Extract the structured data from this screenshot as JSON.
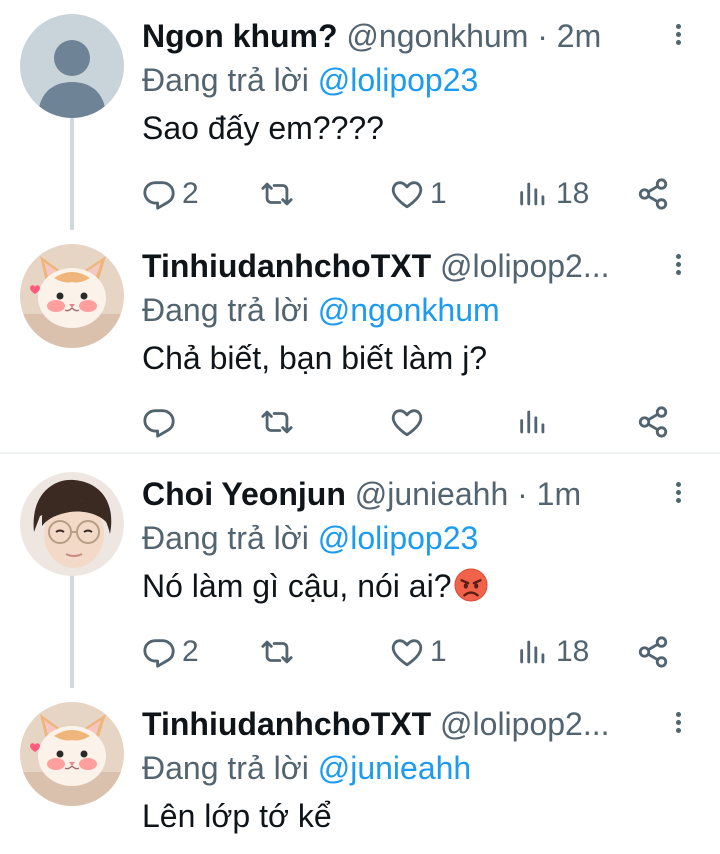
{
  "colors": {
    "text": "#0f1419",
    "secondary": "#536471",
    "link": "#1d9bf0",
    "thread_line": "#cfd9de",
    "divider": "#eff3f4"
  },
  "tweets": [
    {
      "display_name": "Ngon khum?",
      "meta": "@ngonkhum · 2m",
      "reply_prefix": "Đang trả lời",
      "reply_to": "@lolipop23",
      "text": "Sao đấy em????",
      "avatar": "default-avatar",
      "stats": {
        "replies": "2",
        "retweets": "",
        "likes": "1",
        "views": "18"
      }
    },
    {
      "display_name": "TinhiudanhchoTXT",
      "meta": "@lolipop2...",
      "reply_prefix": "Đang trả lời",
      "reply_to": "@ngonkhum",
      "text": "Chả biết, bạn biết làm j?",
      "avatar": "cat-avatar",
      "stats": {
        "replies": "",
        "retweets": "",
        "likes": "",
        "views": ""
      }
    },
    {
      "display_name": "Choi Yeonjun",
      "meta": "@junieahh · 1m",
      "reply_prefix": "Đang trả lời",
      "reply_to": "@lolipop23",
      "text": "Nó làm gì cậu, nói ai?",
      "emoji": "angry-face-emoji",
      "avatar": "person-avatar",
      "stats": {
        "replies": "2",
        "retweets": "",
        "likes": "1",
        "views": "18"
      }
    },
    {
      "display_name": "TinhiudanhchoTXT",
      "meta": "@lolipop2...",
      "reply_prefix": "Đang trả lời",
      "reply_to": "@junieahh",
      "text": "Lên lớp tớ kể",
      "avatar": "cat-avatar"
    }
  ]
}
